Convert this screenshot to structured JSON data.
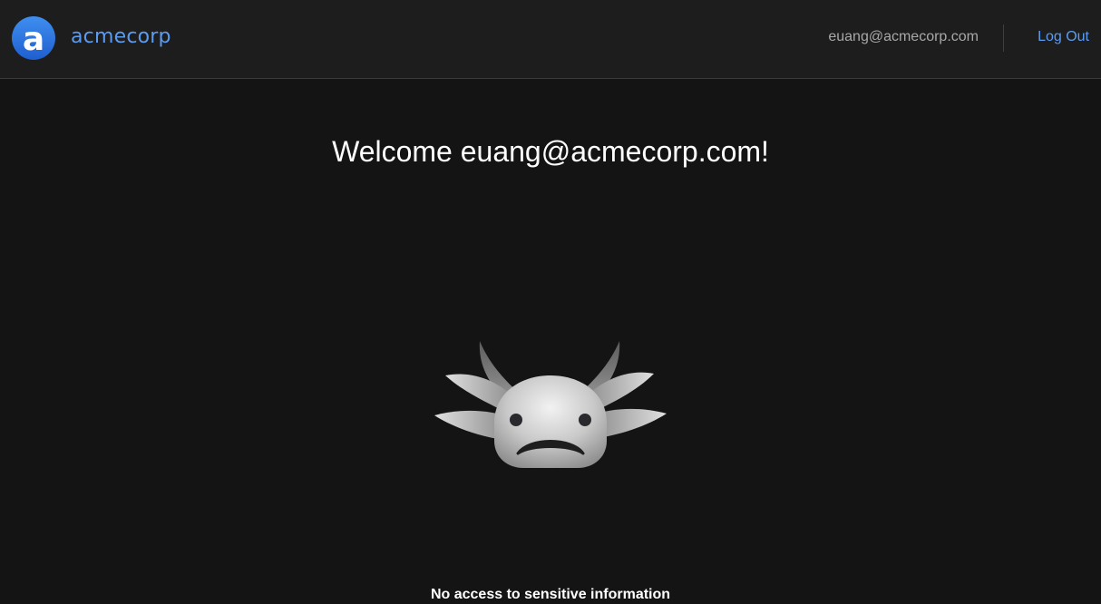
{
  "header": {
    "brand_name": "acmecorp",
    "brand_icon": "acmecorp-logo-icon",
    "user_email": "euang@acmecorp.com",
    "logout_label": "Log Out"
  },
  "main": {
    "welcome_text": "Welcome euang@acmecorp.com!",
    "mascot_icon": "sad-axolotl-icon",
    "access_note": "No access to sensitive information"
  },
  "colors": {
    "page_background": "#141414",
    "header_background": "#1d1d1d",
    "accent": "#5b9bf0",
    "muted_text": "#a8a8a8"
  }
}
